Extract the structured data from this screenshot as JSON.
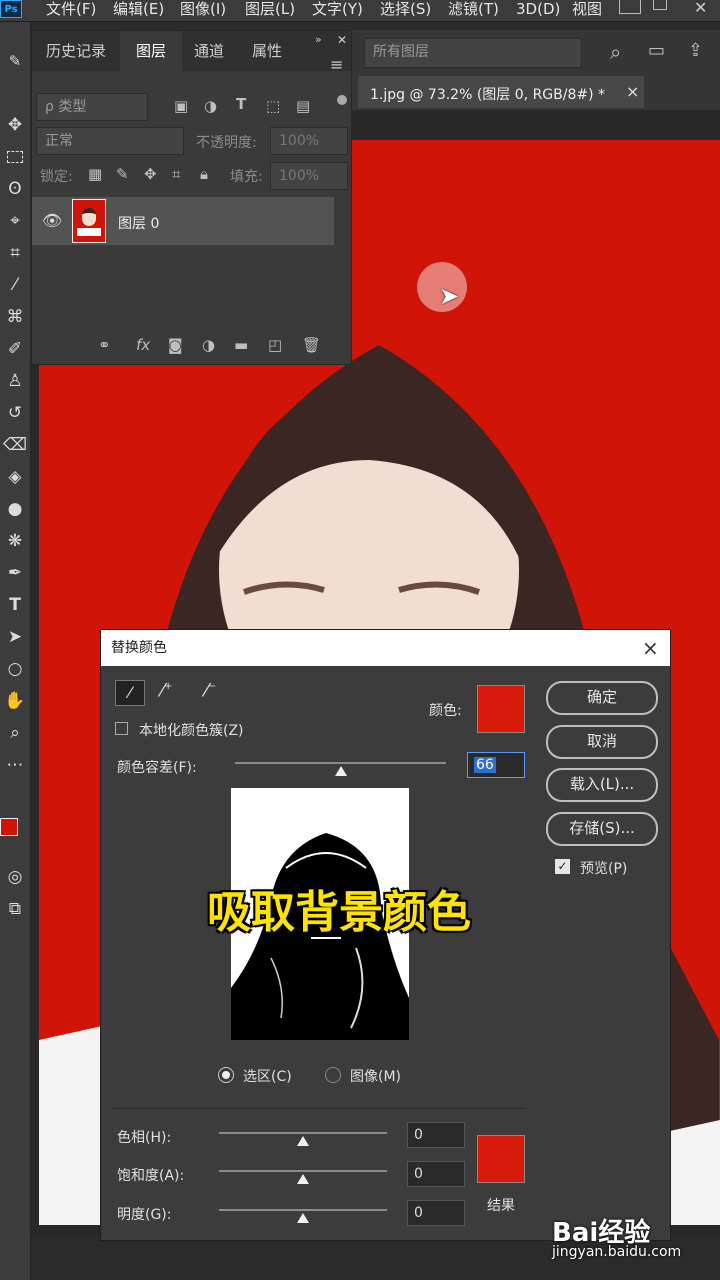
{
  "app": {
    "logo": "Ps"
  },
  "menu": [
    "文件(F)",
    "编辑(E)",
    "图像(I)",
    "图层(L)",
    "文字(Y)",
    "选择(S)",
    "滤镜(T)",
    "3D(D)",
    "视图"
  ],
  "panel": {
    "tabs": [
      "历史记录",
      "图层",
      "通道",
      "属性"
    ],
    "active_tab": "图层",
    "filter_kind": "ρ 类型",
    "blend_mode": "正常",
    "opacity_label": "不透明度:",
    "opacity_value": "100%",
    "lock_label": "锁定:",
    "fill_label": "填充:",
    "fill_value": "100%",
    "layer_name": "图层 0",
    "footer_icons": [
      "link-icon",
      "fx-icon",
      "mask-icon",
      "adjustment-icon",
      "folder-icon",
      "new-layer-icon",
      "trash-icon"
    ]
  },
  "doc": {
    "layer_select_placeholder": "所有图层",
    "tab_title": "1.jpg @ 73.2% (图层 0, RGB/8#) *",
    "tab_close": "×"
  },
  "dialog": {
    "title": "替换颜色",
    "close": "×",
    "localized_label": "本地化颜色簇(Z)",
    "color_label": "颜色:",
    "color_swatch": "#d81a0c",
    "fuzziness_label": "颜色容差(F):",
    "fuzziness_value": "66",
    "fuzziness_level": 0.5,
    "radio_selection": "选区(C)",
    "radio_image": "图像(M)",
    "hue_label": "色相(H):",
    "hue_value": "0",
    "saturation_label": "饱和度(A):",
    "saturation_value": "0",
    "lightness_label": "明度(G):",
    "lightness_value": "0",
    "result_label": "结果",
    "result_swatch": "#d81a0c",
    "ok": "确定",
    "cancel": "取消",
    "load": "载入(L)...",
    "save": "存储(S)...",
    "preview_label": "预览(P)",
    "preview_checked": true
  },
  "overlay_caption": "吸取背景颜色",
  "watermark": {
    "brand": "Bai经验",
    "url": "jingyan.baidu.com"
  },
  "colors": {
    "background_red": "#d01408",
    "foreground": "#d01408",
    "background_swatch": "#000000"
  }
}
